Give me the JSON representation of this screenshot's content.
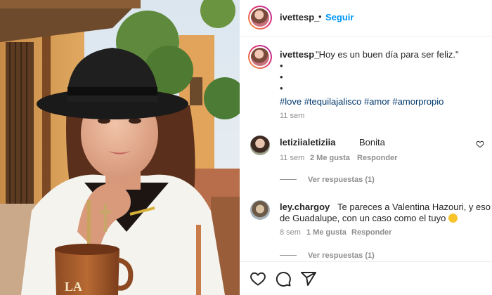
{
  "post": {
    "author": "ivettesp_",
    "separator": "•",
    "follow_label": "Seguir",
    "caption": "\"Hoy es un buen día para ser feliz.\"",
    "bullets": [
      "•",
      "•",
      "•"
    ],
    "hashtags": "#love #tequilajalisco #amor #amorpropio",
    "time": "11 sem"
  },
  "comments": [
    {
      "username": "letiziialetiziia",
      "text": "Bonita",
      "time": "11 sem",
      "likes": "2 Me gusta",
      "reply_label": "Responder",
      "view_replies": "Ver respuestas (1)"
    },
    {
      "username": "ley.chargoy",
      "text_line1": "Te pareces a Valentina Hazouri, y eso por vi",
      "text_line2": "de Guadalupe, con un caso como el tuyo",
      "emoji": "smiling-face",
      "time": "8 sem",
      "likes": "1 Me gusta",
      "reply_label": "Responder",
      "view_replies": "Ver respuestas (1)"
    }
  ],
  "actions": {
    "icons": [
      "heart-icon",
      "comment-icon",
      "share-icon"
    ]
  },
  "photo": {
    "mug_text": "LA"
  },
  "colors": {
    "link_blue": "#0095f6",
    "hashtag_blue": "#00376b",
    "muted_gray": "#8e8e8e",
    "text_dark": "#262626"
  }
}
